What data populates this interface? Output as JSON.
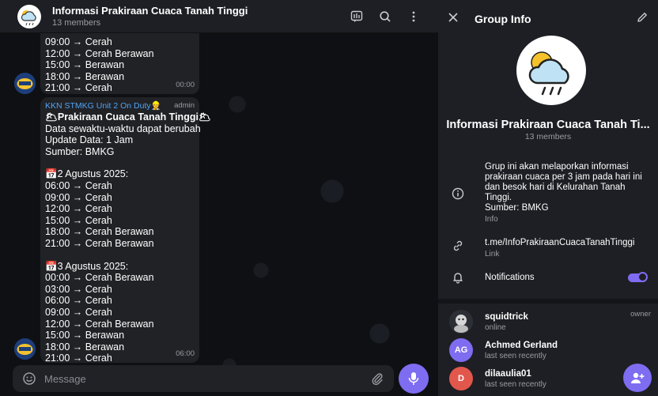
{
  "chat": {
    "title": "Informasi Prakiraan Cuaca Tanah Tinggi",
    "subtitle": "13 members",
    "messages": [
      {
        "lines": [
          "09:00 → Cerah",
          "12:00 → Cerah Berawan",
          "15:00 → Berawan",
          "18:00 → Berawan",
          "21:00 → Cerah"
        ],
        "time": "00:00"
      },
      {
        "sender": "KKN STMKG Unit 2 On Duty👷",
        "role": "admin",
        "heading": "🌥Prakiraan Cuaca Tanah Tinggi🌥",
        "intro": [
          "Data sewaktu-waktu dapat berubah",
          "Update Data: 1 Jam",
          "Sumber: BMKG"
        ],
        "day1": "📅2 Agustus 2025:",
        "day1_lines": [
          "06:00 → Cerah",
          "09:00 → Cerah",
          "12:00 → Cerah",
          "15:00 → Cerah",
          "18:00 → Cerah Berawan",
          "21:00 → Cerah Berawan"
        ],
        "day2": "📅3 Agustus 2025:",
        "day2_lines": [
          "00:00 → Cerah Berawan",
          "03:00 → Cerah",
          "06:00 → Cerah",
          "09:00 → Cerah",
          "12:00 → Cerah Berawan",
          "15:00 → Berawan",
          "18:00 → Berawan",
          "21:00 → Cerah"
        ],
        "time": "06:00"
      }
    ],
    "composer_placeholder": "Message"
  },
  "info": {
    "title": "Group Info",
    "group_name": "Informasi Prakiraan Cuaca Tanah Ti...",
    "members_count": "13 members",
    "description": "Grup ini akan melaporkan informasi prakiraan cuaca per 3 jam pada hari ini dan besok hari di Kelurahan Tanah Tinggi.\nSumber: BMKG",
    "description_label": "Info",
    "link": "t.me/InfoPrakiraanCuacaTanahTinggi",
    "link_label": "Link",
    "notifications_label": "Notifications",
    "notifications_on": true,
    "members": [
      {
        "name": "squidtrick",
        "status": "online",
        "role": "owner",
        "initials": ""
      },
      {
        "name": "Achmed Gerland",
        "status": "last seen recently",
        "role": "",
        "initials": "AG"
      },
      {
        "name": "dilaaulia01",
        "status": "last seen recently",
        "role": "",
        "initials": "D"
      }
    ]
  },
  "colors": {
    "accent": "#7e6cf1",
    "link_blue": "#4ea4f6",
    "avatar_ag": "#7e6cf1",
    "avatar_d": "#e2574c"
  }
}
